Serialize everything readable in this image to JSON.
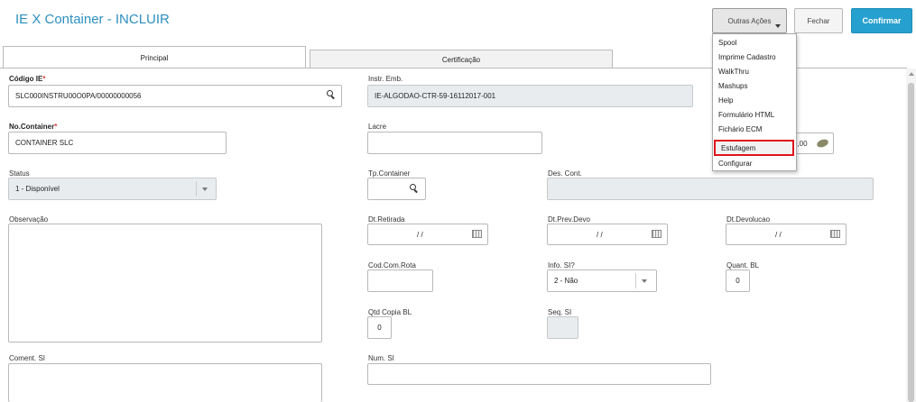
{
  "header": {
    "title": "IE X Container - INCLUIR",
    "outras_acoes": "Outras Ações",
    "fechar": "Fechar",
    "confirmar": "Confirmar",
    "confirm_color": "#26a0cf"
  },
  "tabs": [
    {
      "label": "Principal"
    },
    {
      "label": "Certificação"
    }
  ],
  "menu": {
    "items": [
      "Spool",
      "Imprime Cadastro",
      "WalkThru",
      "Mashups",
      "Help",
      "Formulário HTML",
      "Fichário ECM",
      "Estufagem",
      "Configurar"
    ],
    "highlighted": "Estufagem"
  },
  "form": {
    "codigo_ie": {
      "label": "Código IE",
      "value": "SLC000INSTRU00O0PA/00000000056"
    },
    "instr_emb": {
      "label": "Instr. Emb.",
      "value": "IE-ALGODAO-CTR-59-16112017-001"
    },
    "no_container": {
      "label": "No.Container",
      "value": "CONTAINER SLC"
    },
    "lacre": {
      "label": "Lacre",
      "value": ""
    },
    "partial_value": "0,00",
    "status": {
      "label": "Status",
      "value": "1 - Disponível"
    },
    "tp_container": {
      "label": "Tp.Container",
      "value": ""
    },
    "des_cont": {
      "label": "Des. Cont.",
      "value": ""
    },
    "observacao": {
      "label": "Observação",
      "value": ""
    },
    "dt_retirada": {
      "label": "Dt.Retirada",
      "value": "/ /"
    },
    "dt_prev_devo": {
      "label": "Dt.Prev.Devo",
      "value": "/ /"
    },
    "dt_devolucao": {
      "label": "Dt.Devolucao",
      "value": "/ /"
    },
    "cod_com_rota": {
      "label": "Cod.Com.Rota",
      "value": ""
    },
    "info_si": {
      "label": "Info. SI?",
      "value": "2 - Não"
    },
    "quant_bl": {
      "label": "Quant. BL",
      "value": "0"
    },
    "qtd_copia_bl": {
      "label": "Qtd Copia BL",
      "value": "0"
    },
    "seq_si": {
      "label": "Seq. SI",
      "value": ""
    },
    "coment_si": {
      "label": "Coment. SI",
      "value": ""
    },
    "num_si": {
      "label": "Num. SI",
      "value": ""
    },
    "required_marker": "*"
  }
}
